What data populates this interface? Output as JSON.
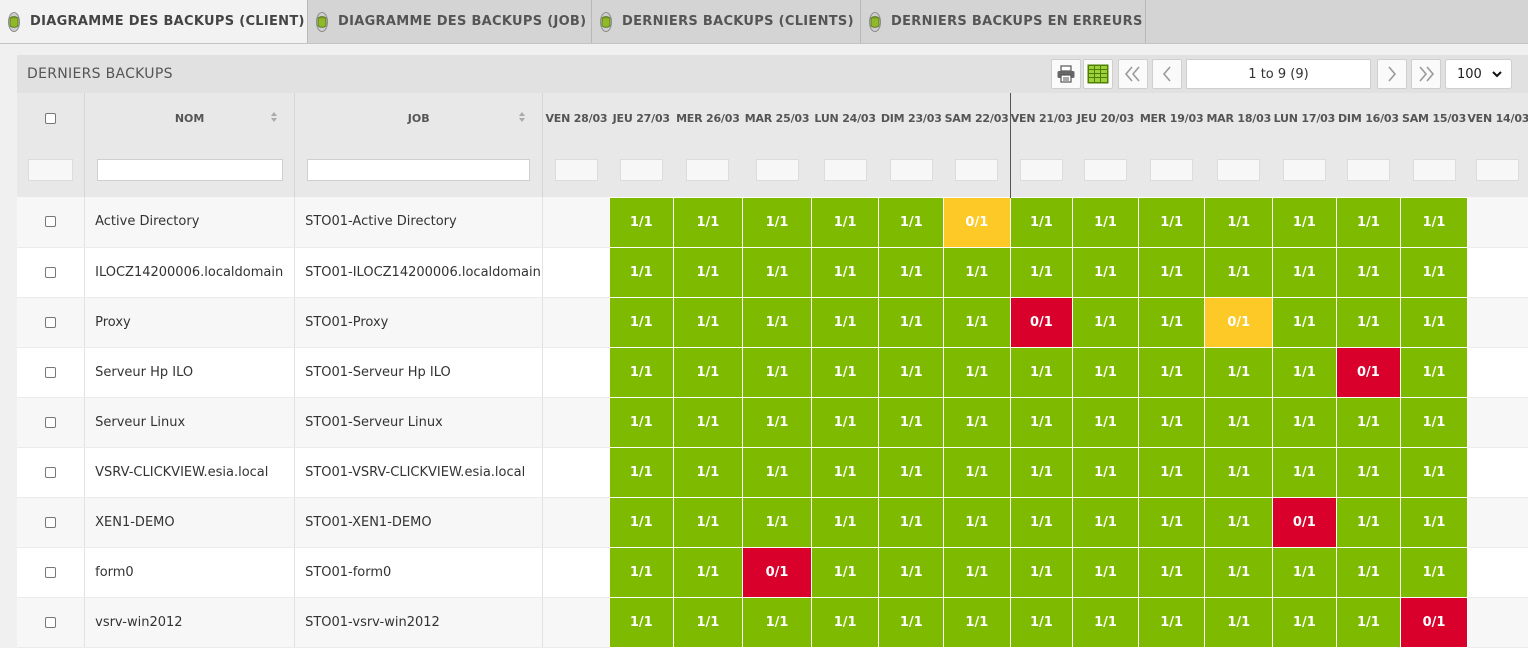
{
  "tabs": [
    {
      "label": "DIAGRAMME DES BACKUPS (CLIENT)",
      "active": true,
      "icon": "database-icon"
    },
    {
      "label": "DIAGRAMME DES BACKUPS (JOB)",
      "active": false,
      "icon": "database-icon"
    },
    {
      "label": "DERNIERS BACKUPS (CLIENTS)",
      "active": false,
      "icon": "database-icon"
    },
    {
      "label": "DERNIERS BACKUPS EN ERREURS",
      "active": false,
      "icon": "database-icon"
    }
  ],
  "panel": {
    "title": "DERNIERS BACKUPS",
    "toolbar": {
      "print_icon": "printer-icon",
      "export_icon": "spreadsheet-icon",
      "first_icon": "double-chevron-left-icon",
      "prev_icon": "chevron-left-icon",
      "pager_text": "1 to 9 (9)",
      "next_icon": "chevron-right-icon",
      "last_icon": "double-chevron-right-icon",
      "page_size": "100"
    }
  },
  "grid": {
    "columns": {
      "name": "NOM",
      "job": "JOB"
    },
    "days": [
      "VEN 28/03",
      "JEU 27/03",
      "MER 26/03",
      "MAR 25/03",
      "LUN 24/03",
      "DIM 23/03",
      "SAM 22/03",
      "VEN 21/03",
      "JEU 20/03",
      "MER 19/03",
      "MAR 18/03",
      "LUN 17/03",
      "DIM 16/03",
      "SAM 15/03",
      "VEN 14/03"
    ],
    "colors": {
      "ok": "#7dba00",
      "warn": "#fcc927",
      "error": "#d9002b"
    },
    "rows": [
      {
        "name": "Active Directory",
        "job": "STO01-Active Directory",
        "cells": [
          "",
          "1/1",
          "1/1",
          "1/1",
          "1/1",
          "1/1",
          "0/1",
          "1/1",
          "1/1",
          "1/1",
          "1/1",
          "1/1",
          "1/1",
          "1/1",
          ""
        ],
        "status": [
          "",
          "ok",
          "ok",
          "ok",
          "ok",
          "ok",
          "warn",
          "ok",
          "ok",
          "ok",
          "ok",
          "ok",
          "ok",
          "ok",
          ""
        ]
      },
      {
        "name": "ILOCZ14200006.localdomain",
        "job": "STO01-ILOCZ14200006.localdomain",
        "cells": [
          "",
          "1/1",
          "1/1",
          "1/1",
          "1/1",
          "1/1",
          "1/1",
          "1/1",
          "1/1",
          "1/1",
          "1/1",
          "1/1",
          "1/1",
          "1/1",
          ""
        ],
        "status": [
          "",
          "ok",
          "ok",
          "ok",
          "ok",
          "ok",
          "ok",
          "ok",
          "ok",
          "ok",
          "ok",
          "ok",
          "ok",
          "ok",
          ""
        ]
      },
      {
        "name": "Proxy",
        "job": "STO01-Proxy",
        "cells": [
          "",
          "1/1",
          "1/1",
          "1/1",
          "1/1",
          "1/1",
          "1/1",
          "0/1",
          "1/1",
          "1/1",
          "0/1",
          "1/1",
          "1/1",
          "1/1",
          ""
        ],
        "status": [
          "",
          "ok",
          "ok",
          "ok",
          "ok",
          "ok",
          "ok",
          "error",
          "ok",
          "ok",
          "warn",
          "ok",
          "ok",
          "ok",
          ""
        ]
      },
      {
        "name": "Serveur Hp ILO",
        "job": "STO01-Serveur Hp ILO",
        "cells": [
          "",
          "1/1",
          "1/1",
          "1/1",
          "1/1",
          "1/1",
          "1/1",
          "1/1",
          "1/1",
          "1/1",
          "1/1",
          "1/1",
          "0/1",
          "1/1",
          ""
        ],
        "status": [
          "",
          "ok",
          "ok",
          "ok",
          "ok",
          "ok",
          "ok",
          "ok",
          "ok",
          "ok",
          "ok",
          "ok",
          "error",
          "ok",
          ""
        ]
      },
      {
        "name": "Serveur Linux",
        "job": "STO01-Serveur Linux",
        "cells": [
          "",
          "1/1",
          "1/1",
          "1/1",
          "1/1",
          "1/1",
          "1/1",
          "1/1",
          "1/1",
          "1/1",
          "1/1",
          "1/1",
          "1/1",
          "1/1",
          ""
        ],
        "status": [
          "",
          "ok",
          "ok",
          "ok",
          "ok",
          "ok",
          "ok",
          "ok",
          "ok",
          "ok",
          "ok",
          "ok",
          "ok",
          "ok",
          ""
        ]
      },
      {
        "name": "VSRV-CLICKVIEW.esia.local",
        "job": "STO01-VSRV-CLICKVIEW.esia.local",
        "cells": [
          "",
          "1/1",
          "1/1",
          "1/1",
          "1/1",
          "1/1",
          "1/1",
          "1/1",
          "1/1",
          "1/1",
          "1/1",
          "1/1",
          "1/1",
          "1/1",
          ""
        ],
        "status": [
          "",
          "ok",
          "ok",
          "ok",
          "ok",
          "ok",
          "ok",
          "ok",
          "ok",
          "ok",
          "ok",
          "ok",
          "ok",
          "ok",
          ""
        ]
      },
      {
        "name": "XEN1-DEMO",
        "job": "STO01-XEN1-DEMO",
        "cells": [
          "",
          "1/1",
          "1/1",
          "1/1",
          "1/1",
          "1/1",
          "1/1",
          "1/1",
          "1/1",
          "1/1",
          "1/1",
          "0/1",
          "1/1",
          "1/1",
          ""
        ],
        "status": [
          "",
          "ok",
          "ok",
          "ok",
          "ok",
          "ok",
          "ok",
          "ok",
          "ok",
          "ok",
          "ok",
          "error",
          "ok",
          "ok",
          ""
        ]
      },
      {
        "name": "form0",
        "job": "STO01-form0",
        "cells": [
          "",
          "1/1",
          "1/1",
          "0/1",
          "1/1",
          "1/1",
          "1/1",
          "1/1",
          "1/1",
          "1/1",
          "1/1",
          "1/1",
          "1/1",
          "1/1",
          ""
        ],
        "status": [
          "",
          "ok",
          "ok",
          "error",
          "ok",
          "ok",
          "ok",
          "ok",
          "ok",
          "ok",
          "ok",
          "ok",
          "ok",
          "ok",
          ""
        ]
      },
      {
        "name": "vsrv-win2012",
        "job": "STO01-vsrv-win2012",
        "cells": [
          "",
          "1/1",
          "1/1",
          "1/1",
          "1/1",
          "1/1",
          "1/1",
          "1/1",
          "1/1",
          "1/1",
          "1/1",
          "1/1",
          "1/1",
          "0/1",
          ""
        ],
        "status": [
          "",
          "ok",
          "ok",
          "ok",
          "ok",
          "ok",
          "ok",
          "ok",
          "ok",
          "ok",
          "ok",
          "ok",
          "ok",
          "error",
          ""
        ]
      }
    ]
  }
}
